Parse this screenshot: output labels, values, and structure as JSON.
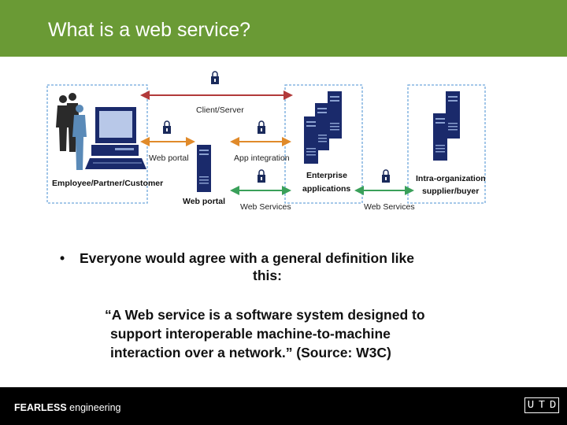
{
  "slide": {
    "title": "What is a web service?",
    "bullet_marker": "•",
    "bullet_line1": "Everyone would agree with a general definition like",
    "bullet_line2": "this:",
    "quote_line1": "“A Web service is a software system designed to",
    "quote_line2": "support interoperable machine-to-machine",
    "quote_line3": "interaction over a network.” (Source: W3C)"
  },
  "diagram": {
    "labels": {
      "client_server": "Client/Server",
      "web_portal_arrow": "Web portal",
      "app_integration": "App integration",
      "employee": "Employee/Partner/Customer",
      "web_portal_server": "Web portal",
      "enterprise_1": "Enterprise",
      "enterprise_2": "applications",
      "intra_1": "Intra-organization",
      "intra_2": "supplier/buyer",
      "web_services_left": "Web Services",
      "web_services_right": "Web Services"
    },
    "colors": {
      "red_arrow": "#b23a3a",
      "orange_arrow": "#e08a2a",
      "green_arrow": "#3aa05a",
      "dashed_box": "#6fa8dc",
      "server": "#1a2a6b",
      "people": "#2a2a2a",
      "lock": "#1a2a5b"
    },
    "icons": [
      "people-icon",
      "desktop-computer-icon",
      "server-icon",
      "lock-icon"
    ]
  },
  "footer": {
    "brand_bold": "FEARLESS",
    "brand_rest": " engineering",
    "logo_letters": [
      "U",
      "T",
      "D"
    ]
  }
}
